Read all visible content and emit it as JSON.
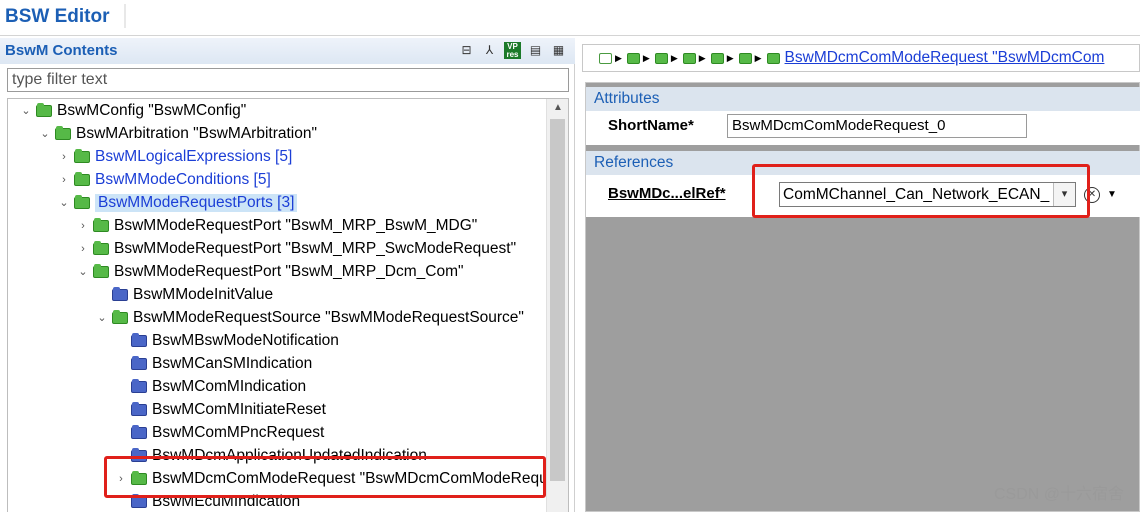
{
  "app": {
    "title": "BSW Editor"
  },
  "left_panel": {
    "title": "BswM Contents",
    "toolbar": [
      {
        "name": "collapse-all-icon",
        "glyph": "⊟"
      },
      {
        "name": "link-editor-icon",
        "glyph": "⅄"
      },
      {
        "name": "vp-res-icon",
        "glyph": "VP res"
      },
      {
        "name": "document-icon",
        "glyph": "▤"
      },
      {
        "name": "table-view-icon",
        "glyph": "▦"
      }
    ],
    "filter": {
      "placeholder": "type filter text",
      "value": ""
    },
    "tree": [
      {
        "label": "BswMConfig \"BswMConfig\"",
        "indent": 0,
        "twisty": "open",
        "color": "green",
        "link": false
      },
      {
        "label": "BswMArbitration \"BswMArbitration\"",
        "indent": 1,
        "twisty": "open",
        "color": "green",
        "link": false
      },
      {
        "label": "BswMLogicalExpressions [5]",
        "indent": 2,
        "twisty": "closed",
        "color": "green",
        "link": true
      },
      {
        "label": "BswMModeConditions [5]",
        "indent": 2,
        "twisty": "closed",
        "color": "green",
        "link": true
      },
      {
        "label": "BswMModeRequestPorts [3]",
        "indent": 2,
        "twisty": "open",
        "color": "green",
        "link": true,
        "selected": true
      },
      {
        "label": "BswMModeRequestPort \"BswM_MRP_BswM_MDG\"",
        "indent": 3,
        "twisty": "closed",
        "color": "green",
        "link": false
      },
      {
        "label": "BswMModeRequestPort \"BswM_MRP_SwcModeRequest\"",
        "indent": 3,
        "twisty": "closed",
        "color": "green",
        "link": false
      },
      {
        "label": "BswMModeRequestPort \"BswM_MRP_Dcm_Com\"",
        "indent": 3,
        "twisty": "open",
        "color": "green",
        "link": false
      },
      {
        "label": "BswMModeInitValue",
        "indent": 4,
        "twisty": "none",
        "color": "blue",
        "link": false
      },
      {
        "label": "BswMModeRequestSource \"BswMModeRequestSource\"",
        "indent": 4,
        "twisty": "open",
        "color": "green",
        "link": false
      },
      {
        "label": "BswMBswModeNotification",
        "indent": 5,
        "twisty": "none",
        "color": "blue",
        "link": false
      },
      {
        "label": "BswMCanSMIndication",
        "indent": 5,
        "twisty": "none",
        "color": "blue",
        "link": false
      },
      {
        "label": "BswMComMIndication",
        "indent": 5,
        "twisty": "none",
        "color": "blue",
        "link": false
      },
      {
        "label": "BswMComMInitiateReset",
        "indent": 5,
        "twisty": "none",
        "color": "blue",
        "link": false
      },
      {
        "label": "BswMComMPncRequest",
        "indent": 5,
        "twisty": "none",
        "color": "blue",
        "link": false
      },
      {
        "label": "BswMDcmApplicationUpdatedIndication",
        "indent": 5,
        "twisty": "none",
        "color": "blue",
        "link": false
      },
      {
        "label": "BswMDcmComModeRequest \"BswMDcmComModeRequest\"",
        "indent": 5,
        "twisty": "closed",
        "color": "green",
        "link": false
      },
      {
        "label": "BswMEcuMIndication",
        "indent": 5,
        "twisty": "none",
        "color": "blue",
        "link": false
      }
    ]
  },
  "right_panel": {
    "breadcrumb": {
      "text": "BswMDcmComModeRequest \"BswMDcmCom"
    },
    "attributes": {
      "header": "Attributes",
      "shortname_label": "ShortName*",
      "shortname_value": "BswMDcmComModeRequest_0"
    },
    "references": {
      "header": "References",
      "ref_label": "BswMDc...elRef*",
      "ref_value": "ComMChannel_Can_Network_ECAN_"
    }
  },
  "watermark": "CSDN @十六宿舍",
  "colors": {
    "highlight": "#e0201a",
    "title_blue": "#1c5fb5",
    "link_blue": "#1b3ed6"
  }
}
